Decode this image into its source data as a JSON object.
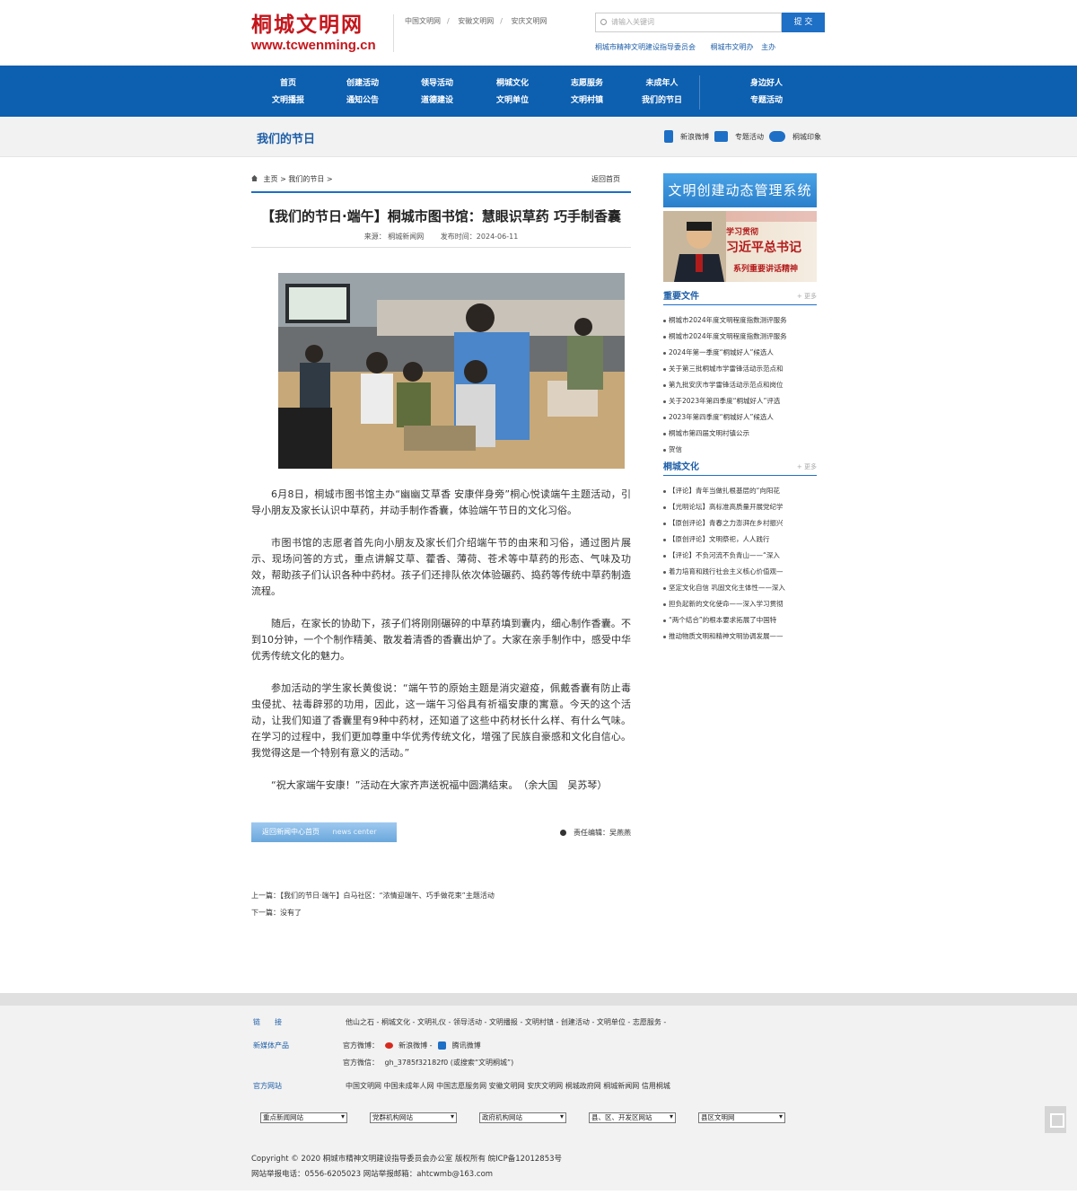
{
  "header": {
    "logo_cn": "桐城文明网",
    "logo_en": "www.tcwenming.cn",
    "toplinks": [
      "中国文明网",
      "安徽文明网",
      "安庆文明网"
    ],
    "search_placeholder": "请输入关键词",
    "search_button": "提 交",
    "sub_org": "桐城市精神文明建设指导委员会",
    "sub_office": "桐城市文明办",
    "sub_host": "主办"
  },
  "nav": [
    [
      "首页",
      "文明播报"
    ],
    [
      "创建活动",
      "通知公告"
    ],
    [
      "领导活动",
      "道德建设"
    ],
    [
      "桐城文化",
      "文明单位"
    ],
    [
      "志愿服务",
      "文明村镇"
    ],
    [
      "未成年人",
      "我们的节日"
    ],
    [
      "身边好人",
      "专题活动"
    ]
  ],
  "section": {
    "title": "我们的节日",
    "tools": [
      "新浪微博",
      "专题活动",
      "桐城印象"
    ]
  },
  "breadcrumb": {
    "home": "主页",
    "sep1": ">",
    "current": "我们的节日",
    "sep2": ">",
    "back": "返回首页"
  },
  "article": {
    "title": "【我们的节日·端午】桐城市图书馆：慧眼识草药 巧手制香囊",
    "source": "来源： 桐城新闻网",
    "date": "发布时间：2024-06-11",
    "paragraphs": [
      "6月8日，桐城市图书馆主办“幽幽艾草香 安康伴身旁”桐心悦读端午主题活动，引导小朋友及家长认识中草药，并动手制作香囊，体验端午节日的文化习俗。",
      "市图书馆的志愿者首先向小朋友及家长们介绍端午节的由来和习俗，通过图片展示、现场问答的方式，重点讲解艾草、藿香、薄荷、苍术等中草药的形态、气味及功效，帮助孩子们认识各种中药材。孩子们还排队依次体验碾药、捣药等传统中草药制造流程。",
      "随后，在家长的协助下，孩子们将刚刚碾碎的中草药填到囊内，细心制作香囊。不到10分钟，一个个制作精美、散发着清香的香囊出炉了。大家在亲手制作中，感受中华优秀传统文化的魅力。",
      "参加活动的学生家长黄俊说：“端午节的原始主题是消灾避疫，佩戴香囊有防止毒虫侵扰、祛毒辟邪的功用，因此，这一端午习俗具有祈福安康的寓意。今天的这个活动，让我们知道了香囊里有9种中药材，还知道了这些中药材长什么样、有什么气味。在学习的过程中，我们更加尊重中华优秀传统文化，增强了民族自豪感和文化自信心。我觉得这是一个特别有意义的活动。”",
      "“祝大家端午安康！”活动在大家齐声送祝福中圆满结束。　（余大国　吴苏琴）"
    ],
    "back_button": "返回新闻中心首页",
    "back_button_en": "news center",
    "editor": "责任编辑：吴燕燕",
    "prev": "上一篇：【我们的节日·端午】白马社区：“浓情迎端午、巧手做花束”主题活动",
    "next": "下一篇：没有了"
  },
  "sidebar": {
    "banner1": "文明创建动态管理系统",
    "banner2_line1": "学习贯彻",
    "banner2_line2": "习近平总书记",
    "banner2_line3": "系列重要讲话精神",
    "box1_title": "重要文件",
    "box1_more": "+ 更多",
    "box1_items": [
      "桐城市2024年度文明程度指数测评服务",
      "桐城市2024年度文明程度指数测评服务",
      "2024年第一季度“桐城好人”候选人",
      "关于第三批桐城市学雷锋活动示范点和",
      "第九批安庆市学雷锋活动示范点和岗位",
      "关于2023年第四季度“桐城好人”评选",
      "2023年第四季度“桐城好人”候选人",
      "桐城市第四届文明村镇公示",
      "贺信"
    ],
    "box2_title": "桐城文化",
    "box2_more": "+ 更多",
    "box2_items": [
      "【评论】青年当做扎根基层的“向阳花",
      "【光明论坛】高标准高质量开展党纪学",
      "【原创评论】青春之力澎湃在乡村振兴",
      "【原创评论】文明祭祀，人人践行",
      "【评论】不负河流不负青山——“深入",
      "着力培育和践行社会主义核心价值观—",
      "坚定文化自信 巩固文化主体性——深入",
      "担负起新的文化使命——深入学习贯彻",
      "“两个结合”的根本要求拓展了中国特",
      "推动物质文明和精神文明协调发展——"
    ]
  },
  "footer": {
    "links_label": "链　　接",
    "links": [
      "他山之石 -",
      "桐城文化 -",
      "文明礼仪 -",
      "领导活动 -",
      "文明播报 -",
      "文明村镇 -",
      "创建活动 -",
      "文明单位 -",
      "志愿服务 -"
    ],
    "media_label": "新媒体产品",
    "weibo_label": "官方微博：",
    "weibo_sina": "新浪微博",
    "weibo_sep": "-",
    "weibo_tencent": "腾讯微博",
    "wechat_label": "官方微信：",
    "wechat_value": "gh_3785f32182f0 (或搜索“文明桐城”)",
    "official_label": "官方网站",
    "official_sites": [
      "中国文明网",
      "中国未成年人网",
      "中国志愿服务网",
      "安徽文明网",
      "安庆文明网",
      "桐城政府网",
      "桐城新闻网",
      "信用桐城"
    ],
    "selects": [
      "重点新闻网站",
      "党群机构网站",
      "政府机构网站",
      "县、区、开发区网站",
      "县区文明网"
    ],
    "copyright": "Copyright © 2020 桐城市精神文明建设指导委员会办公室 版权所有 皖ICP备12012853号",
    "report": "网站举报电话：0556-6205023 网站举报邮箱：ahtcwmb@163.com"
  },
  "colors": {
    "brand_red": "#c4161c",
    "nav_blue": "#0d5fb0",
    "accent_blue": "#1e6fc6"
  }
}
